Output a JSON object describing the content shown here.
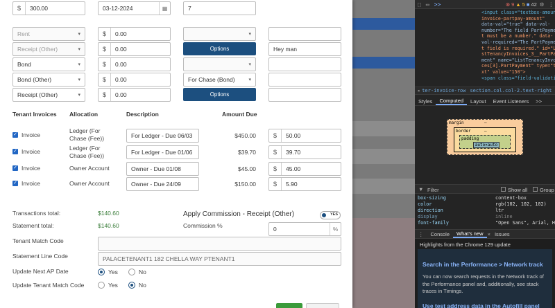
{
  "top_row": {
    "amount": "300.00",
    "date": "03-12-2024",
    "qty": "7",
    "currency_symbol": "$",
    "calendar_icon": "calendar-icon"
  },
  "allocation_rows": [
    {
      "type": "Rent",
      "amount": "0.00",
      "chase": "",
      "note": "",
      "type_disabled": true
    },
    {
      "type": "Receipt (Other)",
      "amount": "0.00",
      "chase": "Options",
      "note": "Hey man",
      "type_disabled": true
    },
    {
      "type": "Bond",
      "amount": "0.00",
      "chase": "",
      "note": "",
      "type_disabled": false
    },
    {
      "type": "Bond (Other)",
      "amount": "0.00",
      "chase": "For Chase (Bond)",
      "note": "",
      "type_disabled": false
    },
    {
      "type": "Receipt (Other)",
      "amount": "0.00",
      "chase": "Options",
      "note": "",
      "type_disabled": false
    }
  ],
  "invoices_table": {
    "headers": {
      "tenant_invoices": "Tenant Invoices",
      "allocation": "Allocation",
      "description": "Description",
      "amount_due": "Amount Due"
    },
    "rows": [
      {
        "label": "Invoice",
        "allocation": "Ledger (For Chase (Fee))",
        "description": "For Ledger - Due 06/03",
        "amount_due": "$450.00",
        "payment": "50.00"
      },
      {
        "label": "Invoice",
        "allocation": "Ledger (For Chase (Fee))",
        "description": "For Ledger - Due 01/06",
        "amount_due": "$39.70",
        "payment": "39.70"
      },
      {
        "label": "Invoice",
        "allocation": "Owner Account",
        "description": "Owner - Due 01/08",
        "amount_due": "$45.00",
        "payment": "45.00"
      },
      {
        "label": "Invoice",
        "allocation": "Owner Account",
        "description": "Owner - Due 24/09",
        "amount_due": "$150.00",
        "payment": "5.90"
      }
    ]
  },
  "totals": {
    "transactions_label": "Transactions total:",
    "transactions_value": "$140.60",
    "statement_label": "Statement total:",
    "statement_value": "$140.60"
  },
  "commission": {
    "title": "Apply Commission - Receipt (Other)",
    "toggle_label": "YES",
    "percent_label": "Commission %",
    "percent_value": "0",
    "percent_suffix": "%"
  },
  "tenant_match": {
    "label": "Tenant Match Code",
    "value": ""
  },
  "statement_line": {
    "label": "Statement Line Code",
    "value": "PALACETENANT1  182 CHELLA WAY PTENANT1"
  },
  "update_ap": {
    "label": "Update Next AP Date",
    "yes": "Yes",
    "no": "No",
    "selected": "yes"
  },
  "update_match": {
    "label": "Update Tenant Match Code",
    "yes": "Yes",
    "no": "No",
    "selected": "no"
  },
  "colors": {
    "primary": "#1c4f7f",
    "checkbox": "#2166c4",
    "total_green": "#3a7d3a"
  },
  "devtools": {
    "topbar": {
      "more": ">>",
      "errors": "9",
      "warnings": "5",
      "issues": "42"
    },
    "code_lines": [
      "<input class=\"textbox-amount",
      "invoice-partpay-amount\"",
      "data-val=\"true\" data-val-",
      "number=\"The field PartPayme",
      "t must be a number.\" data-",
      "val-required=\"The PartPaymen",
      "t field is required.\" id=\"L",
      "stTenancyInvoices_3__PartPa",
      "ment\" name=\"ListTenancyInvo",
      "ces[3].PartPayment\" type=\"te",
      "xt\" value=\"150\">",
      "<span class=\"field-validati"
    ],
    "breadcrumb": [
      "ter-invoice-row",
      "section.col.col-2.text-right",
      "span",
      ">"
    ],
    "tabs": [
      "Styles",
      "Computed",
      "Layout",
      "Event Listeners",
      ">>"
    ],
    "box_model": {
      "margin": "margin",
      "border": "border",
      "padding": "padding",
      "content": "auto×auto",
      "dash": "–"
    },
    "filter": {
      "placeholder": "Filter",
      "show_all": "Show all",
      "group": "Group"
    },
    "props": [
      {
        "name": "box-sizing",
        "value": "content-box",
        "dim": false
      },
      {
        "name": "color",
        "value": "rgb(102, 102, 102)",
        "dim": false
      },
      {
        "name": "direction",
        "value": "ltr",
        "dim": false
      },
      {
        "name": "display",
        "value": "inline",
        "dim": true
      },
      {
        "name": "font-family",
        "value": "\"Open Sans\", Arial, H",
        "dim": false
      }
    ],
    "console_tabs": [
      "Console",
      "What's new",
      "Issues"
    ],
    "news_header": "Highlights from the Chrome 129 update",
    "news_title_1": "Search in the Performance > Network track",
    "news_body_1": "You can now search requests in the Network track of the Performance panel and, additionally, see stack traces in Timings.",
    "news_title_2": "Use test address data in the Autofill panel"
  }
}
